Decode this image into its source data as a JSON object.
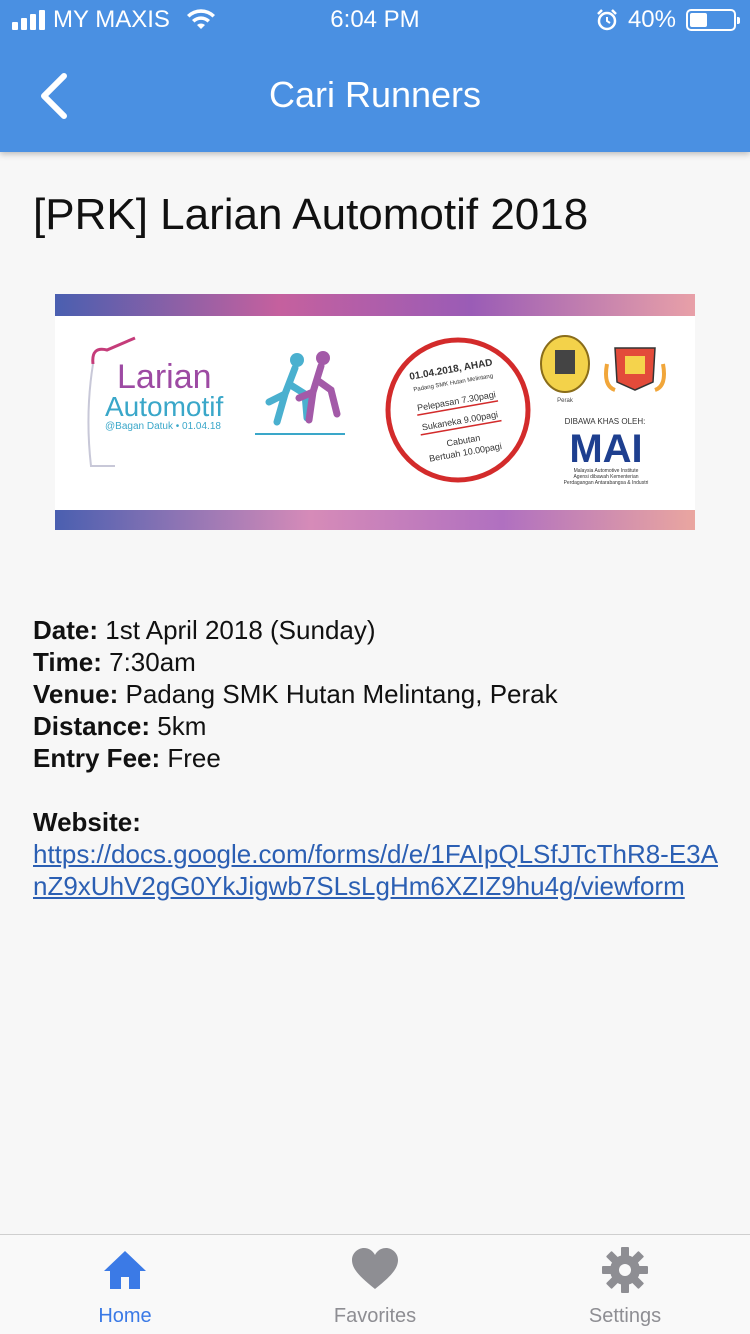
{
  "status_bar": {
    "carrier": "MY MAXIS",
    "time": "6:04 PM",
    "battery": "40%"
  },
  "nav": {
    "title": "Cari Runners"
  },
  "event": {
    "title": "[PRK] Larian Automotif 2018",
    "banner": {
      "title_line1": "Larian",
      "title_line2": "Automotif",
      "location_date": "@Bagan Datuk • 01.04.18",
      "circle_line1": "01.04.2018, AHAD",
      "circle_line2": "Padang SMK Hutan Melintang",
      "circle_line3": "Pelepasan 7.30pagi",
      "circle_line4": "Sukaneka 9.00pagi",
      "circle_line5": "Cabutan",
      "circle_line6": "Bertuah 10.00pagi",
      "organizer_label": "DIBAWA KHAS OLEH:",
      "organizer_logo": "MAI",
      "organizer_line1": "Malaysia Automotive Institute",
      "organizer_line2": "Agensi dibawah Kementerian",
      "organizer_line3": "Perdagangan Antarabangsa & Industri",
      "crest_caption": "Perak"
    },
    "details": [
      {
        "label": "Date:",
        "value": "1st April 2018 (Sunday)"
      },
      {
        "label": "Time:",
        "value": "7:30am"
      },
      {
        "label": "Venue:",
        "value": "Padang SMK Hutan Melintang, Perak"
      },
      {
        "label": "Distance:",
        "value": "5km"
      },
      {
        "label": "Entry Fee:",
        "value": "Free"
      }
    ],
    "website_label": "Website:",
    "website_url": "https://docs.google.com/forms/d/e/1FAIpQLSfJTcThR8-E3AnZ9xUhV2gG0YkJigwb7SLsLgHm6XZIZ9hu4g/viewform"
  },
  "tabs": [
    {
      "label": "Home",
      "icon": "home-icon",
      "active": true
    },
    {
      "label": "Favorites",
      "icon": "heart-icon",
      "active": false
    },
    {
      "label": "Settings",
      "icon": "gear-icon",
      "active": false
    }
  ],
  "colors": {
    "header": "#4a90e2",
    "active_tab": "#3b7ae6",
    "inactive_tab": "#8e8e93",
    "link": "#2b5fb3"
  }
}
